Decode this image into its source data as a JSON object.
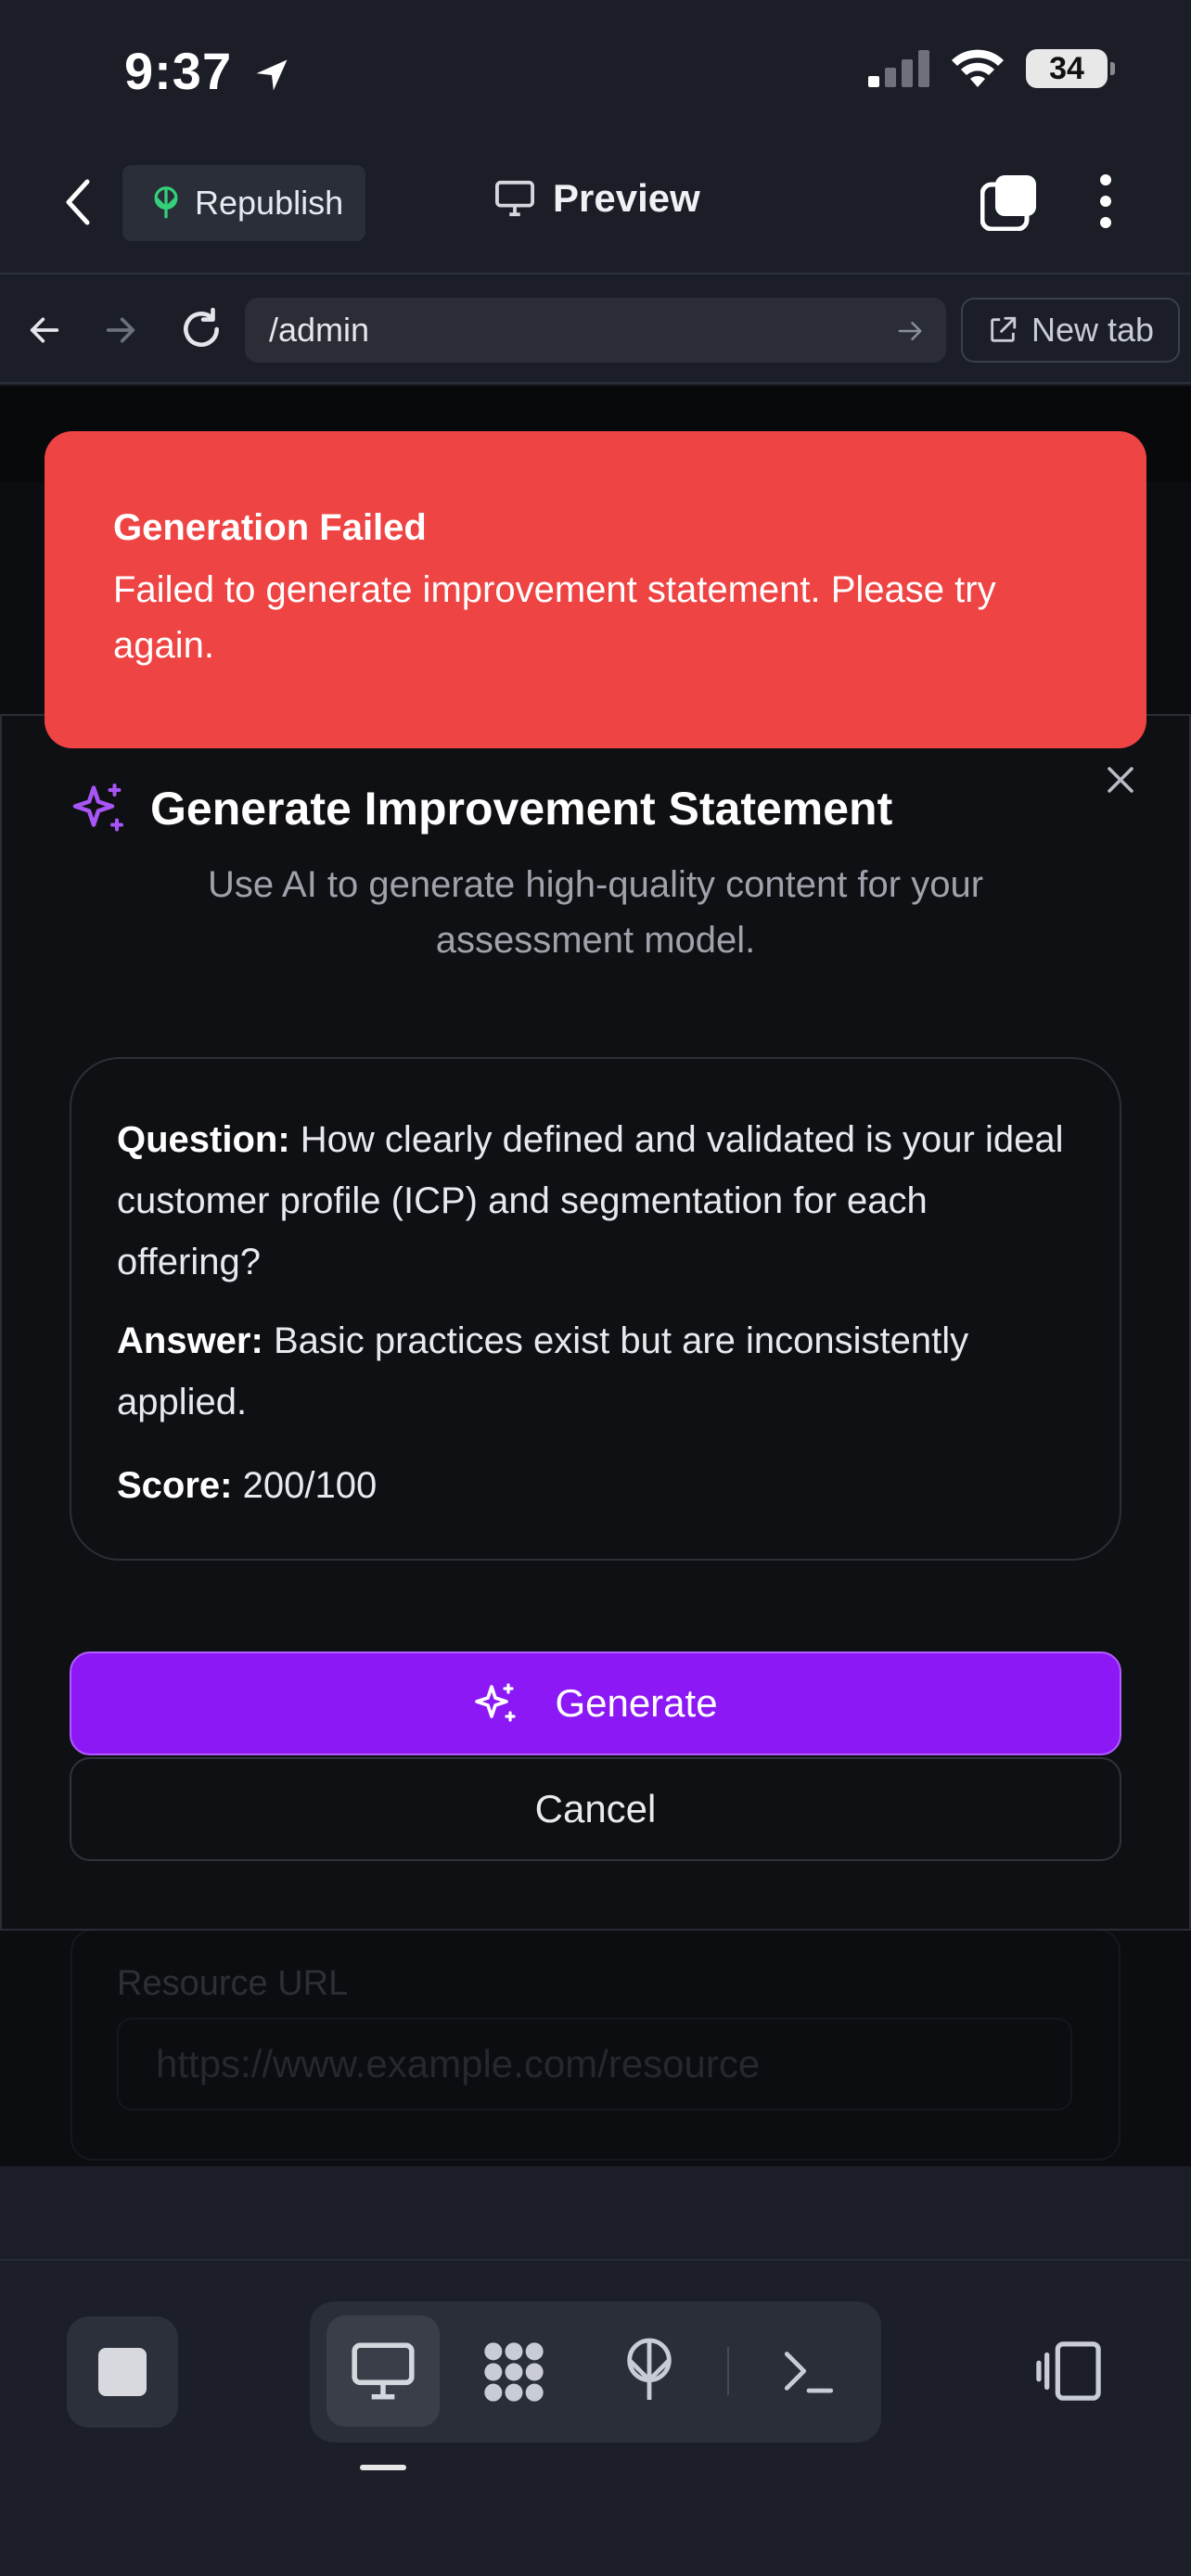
{
  "status_bar": {
    "time": "9:37",
    "battery": "34",
    "icons": [
      "location-arrow-icon",
      "signal-icon",
      "wifi-icon",
      "battery-icon"
    ]
  },
  "top_bar": {
    "republish_label": "Republish",
    "preview_label": "Preview",
    "icons": [
      "back-chevron-icon",
      "republish-icon",
      "monitor-icon",
      "duplicate-icon",
      "more-vertical-icon"
    ]
  },
  "browser": {
    "url": "/admin",
    "new_tab_label": "New tab",
    "icons": [
      "back-arrow-icon",
      "forward-arrow-icon",
      "reload-icon",
      "go-arrow-icon",
      "external-link-icon"
    ]
  },
  "toast": {
    "title": "Generation Failed",
    "message": "Failed to generate improvement statement. Please try again.",
    "color": "#ef4444"
  },
  "modal": {
    "title": "Generate Improvement Statement",
    "subtitle": "Use AI to generate high-quality content for your assessment model.",
    "question_label": "Question:",
    "question_text": "How clearly defined and validated is your ideal customer profile (ICP) and segmentation for each offering?",
    "answer_label": "Answer:",
    "answer_text": "Basic practices exist but are inconsistently applied.",
    "score_label": "Score:",
    "score_value": "200/100",
    "generate_label": "Generate",
    "cancel_label": "Cancel",
    "accent": "#8c19f5",
    "icons": [
      "sparkles-icon",
      "close-icon"
    ]
  },
  "background_form": {
    "label": "Resource URL",
    "placeholder": "https://www.example.com/resource"
  },
  "bottom_toolbar": {
    "icons": [
      "stop-icon",
      "desktop-icon",
      "grid-pattern-icon",
      "deploy-icon",
      "terminal-icon",
      "devices-icon"
    ]
  }
}
